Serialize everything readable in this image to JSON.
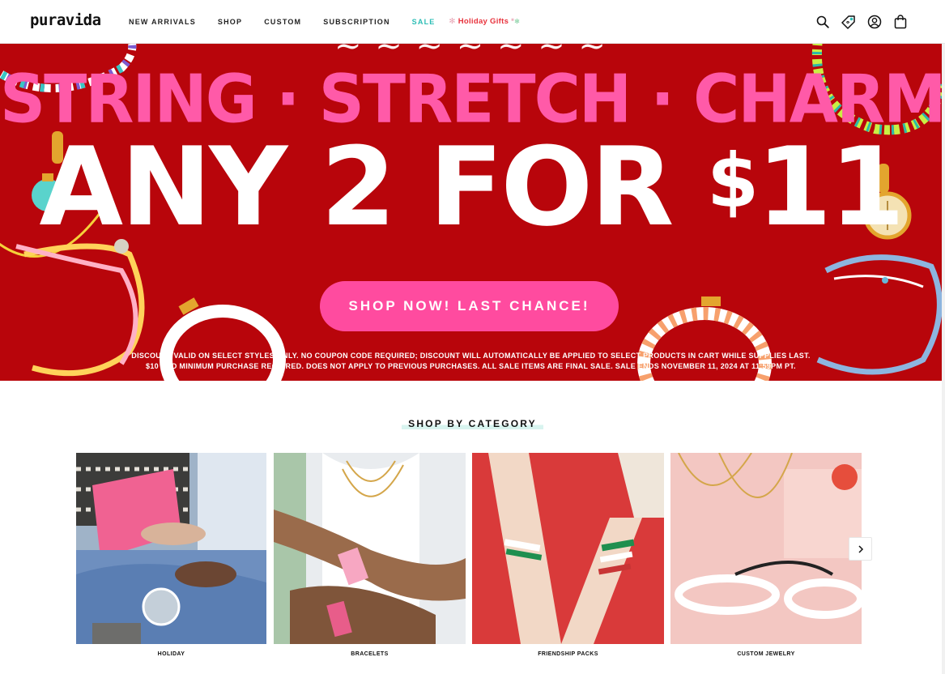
{
  "header": {
    "logo": "puravida",
    "nav": [
      {
        "label": "NEW ARRIVALS",
        "name": "nav-new-arrivals"
      },
      {
        "label": "SHOP",
        "name": "nav-shop"
      },
      {
        "label": "CUSTOM",
        "name": "nav-custom"
      },
      {
        "label": "SUBSCRIPTION",
        "name": "nav-subscription"
      },
      {
        "label": "SALE",
        "name": "nav-sale"
      }
    ],
    "holiday_label": "Holiday Gifts",
    "icons": [
      "search-icon",
      "rewards-tag-icon",
      "account-icon",
      "cart-bag-icon"
    ]
  },
  "hero": {
    "line1": "STRING · STRETCH · CHARMS",
    "line2_prefix": "ANY 2 FOR ",
    "line2_currency": "$",
    "line2_amount": "11",
    "cta": "SHOP NOW! LAST CHANCE!",
    "fine_print_1": "DISCOUNT VALID ON SELECT STYLES ONLY. NO COUPON CODE REQUIRED; DISCOUNT WILL AUTOMATICALLY BE APPLIED TO SELECT PRODUCTS IN CART WHILE SUPPLIES LAST.",
    "fine_print_2": "$10 USD MINIMUM PURCHASE REQUIRED. DOES NOT APPLY TO PREVIOUS PURCHASES. ALL SALE ITEMS ARE FINAL SALE. SALE ENDS NOVEMBER 11, 2024 AT 11:59PM PT."
  },
  "categories": {
    "title": "SHOP BY CATEGORY",
    "items": [
      {
        "label": "HOLIDAY"
      },
      {
        "label": "BRACELETS"
      },
      {
        "label": "FRIENDSHIP PACKS"
      },
      {
        "label": "CUSTOM JEWELRY"
      }
    ]
  },
  "colors": {
    "hero_bg": "#b8050b",
    "hero_pink": "#ff5aa8",
    "cta_bg": "#ff4b9f",
    "sale_teal": "#2bbdb5",
    "holiday_red": "#e8323c"
  }
}
